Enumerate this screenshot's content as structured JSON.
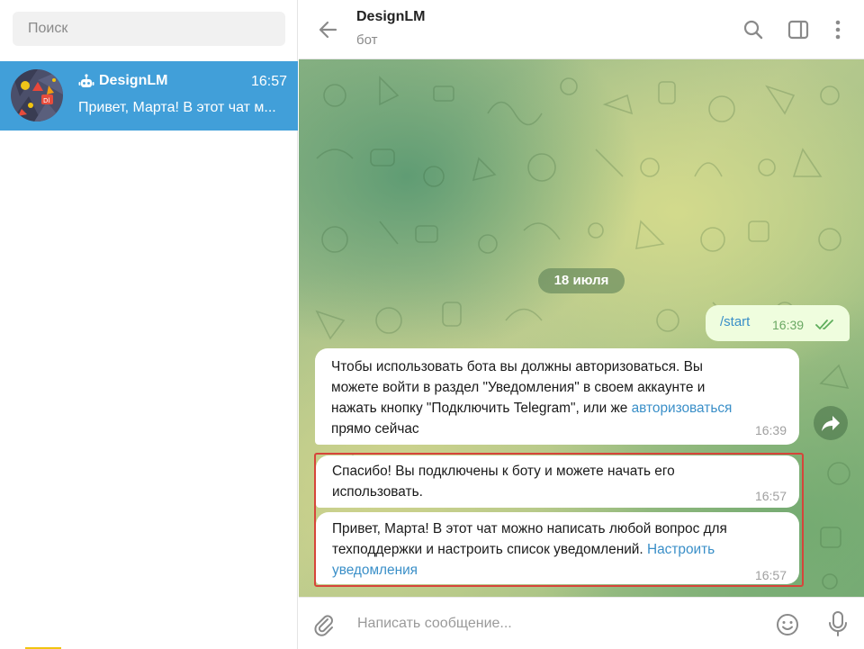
{
  "sidebar": {
    "search_placeholder": "Поиск",
    "chat": {
      "name": "DesignLM",
      "time": "16:57",
      "preview": "Привет, Марта! В этот чат м...",
      "avatar_icon": "designlm-avatar"
    }
  },
  "header": {
    "title": "DesignLM",
    "subtitle": "бот",
    "icons": [
      "back-arrow-icon",
      "search-icon",
      "sidebar-toggle-icon",
      "more-vert-icon"
    ]
  },
  "messages": {
    "date_divider": "18 июля",
    "outgoing": {
      "text": "/start",
      "time": "16:39",
      "status": "read"
    },
    "incoming": [
      {
        "lines": [
          "Чтобы использовать бота вы должны авторизоваться. Вы",
          "можете войти в раздел \"Уведомления\" в своем аккаунте и",
          "нажать кнопку \"Подключить Telegram\", или же "
        ],
        "link": "авторизоваться",
        "after": "прямо сейчас",
        "time": "16:39"
      },
      {
        "lines": [
          "Спасибо! Вы подключены к боту и можете начать его",
          "использовать."
        ],
        "time": "16:57"
      },
      {
        "lines": [
          "Привет, Марта! В этот чат можно написать любой вопрос для",
          "техподдержки и настроить список уведомлений. "
        ],
        "link_1": "Настроить",
        "link_2": "уведомления",
        "time": "16:57"
      }
    ]
  },
  "composer": {
    "placeholder": "Написать сообщение..."
  },
  "colors": {
    "accent": "#419fd9",
    "link": "#3a8fc8",
    "outgoing_bg": "#effdde",
    "highlight": "#d6453a"
  }
}
